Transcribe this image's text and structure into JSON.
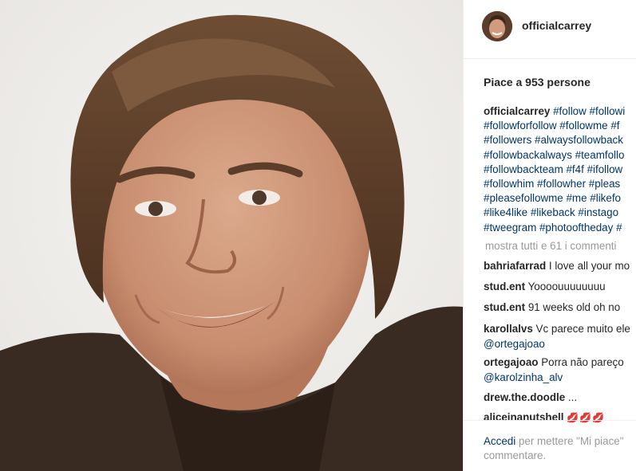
{
  "post": {
    "username": "officialcarrey",
    "likes_text": "Piace a 953 persone",
    "caption": {
      "username": "officialcarrey",
      "lines": [
        [
          "#follow",
          "#followi"
        ],
        [
          "#followforfollow",
          "#followme",
          "#f"
        ],
        [
          "#followers",
          "#alwaysfollowback"
        ],
        [
          "#followbackalways",
          "#teamfollo"
        ],
        [
          "#followbackteam",
          "#f4f",
          "#ifollow"
        ],
        [
          "#followhim",
          "#followher",
          "#pleas"
        ],
        [
          "#pleasefollowme",
          "#me",
          "#likefo"
        ],
        [
          "#like4like",
          "#likeback",
          "#instago"
        ],
        [
          "#tweegram",
          "#photooftheday",
          "#"
        ]
      ]
    },
    "show_all_comments": "mostra tutti e 61 i commenti",
    "comments": [
      {
        "user": "bahriafarrad",
        "text": "I love all your mo"
      },
      {
        "user": "stud.ent",
        "text": "Yoooouuuuuuuu"
      },
      {
        "user": "stud.ent",
        "text": "91 weeks old oh no"
      },
      {
        "user": "karollalvs",
        "text": "Vc parece muito ele",
        "mention": "@ortegajoao"
      },
      {
        "user": "ortegajoao",
        "text": "Porra não pareço",
        "mention": "@karolzinha_alv"
      },
      {
        "user": "drew.the.doodle",
        "text": "..."
      },
      {
        "user": "aliceinanutshell",
        "text": "💋💋💋"
      }
    ],
    "login_prompt": {
      "link": "Accedi",
      "rest": " per mettere \"Mi piace\"",
      "line2": "commentare."
    }
  },
  "colors": {
    "link": "#003569",
    "muted": "#999999",
    "text": "#262626",
    "border": "#efefef"
  }
}
